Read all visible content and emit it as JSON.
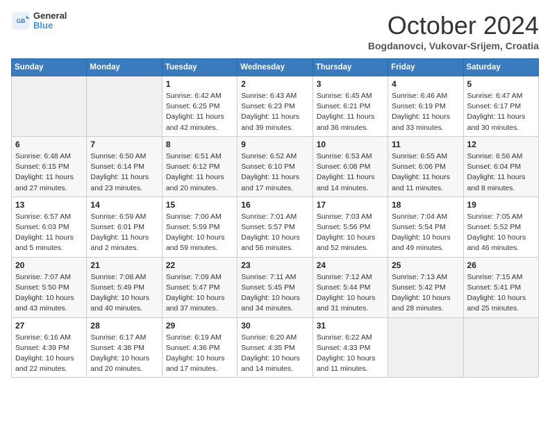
{
  "header": {
    "logo_general": "General",
    "logo_blue": "Blue",
    "title": "October 2024",
    "location": "Bogdanovci, Vukovar-Srijem, Croatia"
  },
  "days_of_week": [
    "Sunday",
    "Monday",
    "Tuesday",
    "Wednesday",
    "Thursday",
    "Friday",
    "Saturday"
  ],
  "weeks": [
    [
      {
        "day": "",
        "sunrise": "",
        "sunset": "",
        "daylight": ""
      },
      {
        "day": "",
        "sunrise": "",
        "sunset": "",
        "daylight": ""
      },
      {
        "day": "1",
        "sunrise": "Sunrise: 6:42 AM",
        "sunset": "Sunset: 6:25 PM",
        "daylight": "Daylight: 11 hours and 42 minutes."
      },
      {
        "day": "2",
        "sunrise": "Sunrise: 6:43 AM",
        "sunset": "Sunset: 6:23 PM",
        "daylight": "Daylight: 11 hours and 39 minutes."
      },
      {
        "day": "3",
        "sunrise": "Sunrise: 6:45 AM",
        "sunset": "Sunset: 6:21 PM",
        "daylight": "Daylight: 11 hours and 36 minutes."
      },
      {
        "day": "4",
        "sunrise": "Sunrise: 6:46 AM",
        "sunset": "Sunset: 6:19 PM",
        "daylight": "Daylight: 11 hours and 33 minutes."
      },
      {
        "day": "5",
        "sunrise": "Sunrise: 6:47 AM",
        "sunset": "Sunset: 6:17 PM",
        "daylight": "Daylight: 11 hours and 30 minutes."
      }
    ],
    [
      {
        "day": "6",
        "sunrise": "Sunrise: 6:48 AM",
        "sunset": "Sunset: 6:15 PM",
        "daylight": "Daylight: 11 hours and 27 minutes."
      },
      {
        "day": "7",
        "sunrise": "Sunrise: 6:50 AM",
        "sunset": "Sunset: 6:14 PM",
        "daylight": "Daylight: 11 hours and 23 minutes."
      },
      {
        "day": "8",
        "sunrise": "Sunrise: 6:51 AM",
        "sunset": "Sunset: 6:12 PM",
        "daylight": "Daylight: 11 hours and 20 minutes."
      },
      {
        "day": "9",
        "sunrise": "Sunrise: 6:52 AM",
        "sunset": "Sunset: 6:10 PM",
        "daylight": "Daylight: 11 hours and 17 minutes."
      },
      {
        "day": "10",
        "sunrise": "Sunrise: 6:53 AM",
        "sunset": "Sunset: 6:08 PM",
        "daylight": "Daylight: 11 hours and 14 minutes."
      },
      {
        "day": "11",
        "sunrise": "Sunrise: 6:55 AM",
        "sunset": "Sunset: 6:06 PM",
        "daylight": "Daylight: 11 hours and 11 minutes."
      },
      {
        "day": "12",
        "sunrise": "Sunrise: 6:56 AM",
        "sunset": "Sunset: 6:04 PM",
        "daylight": "Daylight: 11 hours and 8 minutes."
      }
    ],
    [
      {
        "day": "13",
        "sunrise": "Sunrise: 6:57 AM",
        "sunset": "Sunset: 6:03 PM",
        "daylight": "Daylight: 11 hours and 5 minutes."
      },
      {
        "day": "14",
        "sunrise": "Sunrise: 6:59 AM",
        "sunset": "Sunset: 6:01 PM",
        "daylight": "Daylight: 11 hours and 2 minutes."
      },
      {
        "day": "15",
        "sunrise": "Sunrise: 7:00 AM",
        "sunset": "Sunset: 5:59 PM",
        "daylight": "Daylight: 10 hours and 59 minutes."
      },
      {
        "day": "16",
        "sunrise": "Sunrise: 7:01 AM",
        "sunset": "Sunset: 5:57 PM",
        "daylight": "Daylight: 10 hours and 56 minutes."
      },
      {
        "day": "17",
        "sunrise": "Sunrise: 7:03 AM",
        "sunset": "Sunset: 5:56 PM",
        "daylight": "Daylight: 10 hours and 52 minutes."
      },
      {
        "day": "18",
        "sunrise": "Sunrise: 7:04 AM",
        "sunset": "Sunset: 5:54 PM",
        "daylight": "Daylight: 10 hours and 49 minutes."
      },
      {
        "day": "19",
        "sunrise": "Sunrise: 7:05 AM",
        "sunset": "Sunset: 5:52 PM",
        "daylight": "Daylight: 10 hours and 46 minutes."
      }
    ],
    [
      {
        "day": "20",
        "sunrise": "Sunrise: 7:07 AM",
        "sunset": "Sunset: 5:50 PM",
        "daylight": "Daylight: 10 hours and 43 minutes."
      },
      {
        "day": "21",
        "sunrise": "Sunrise: 7:08 AM",
        "sunset": "Sunset: 5:49 PM",
        "daylight": "Daylight: 10 hours and 40 minutes."
      },
      {
        "day": "22",
        "sunrise": "Sunrise: 7:09 AM",
        "sunset": "Sunset: 5:47 PM",
        "daylight": "Daylight: 10 hours and 37 minutes."
      },
      {
        "day": "23",
        "sunrise": "Sunrise: 7:11 AM",
        "sunset": "Sunset: 5:45 PM",
        "daylight": "Daylight: 10 hours and 34 minutes."
      },
      {
        "day": "24",
        "sunrise": "Sunrise: 7:12 AM",
        "sunset": "Sunset: 5:44 PM",
        "daylight": "Daylight: 10 hours and 31 minutes."
      },
      {
        "day": "25",
        "sunrise": "Sunrise: 7:13 AM",
        "sunset": "Sunset: 5:42 PM",
        "daylight": "Daylight: 10 hours and 28 minutes."
      },
      {
        "day": "26",
        "sunrise": "Sunrise: 7:15 AM",
        "sunset": "Sunset: 5:41 PM",
        "daylight": "Daylight: 10 hours and 25 minutes."
      }
    ],
    [
      {
        "day": "27",
        "sunrise": "Sunrise: 6:16 AM",
        "sunset": "Sunset: 4:39 PM",
        "daylight": "Daylight: 10 hours and 22 minutes."
      },
      {
        "day": "28",
        "sunrise": "Sunrise: 6:17 AM",
        "sunset": "Sunset: 4:38 PM",
        "daylight": "Daylight: 10 hours and 20 minutes."
      },
      {
        "day": "29",
        "sunrise": "Sunrise: 6:19 AM",
        "sunset": "Sunset: 4:36 PM",
        "daylight": "Daylight: 10 hours and 17 minutes."
      },
      {
        "day": "30",
        "sunrise": "Sunrise: 6:20 AM",
        "sunset": "Sunset: 4:35 PM",
        "daylight": "Daylight: 10 hours and 14 minutes."
      },
      {
        "day": "31",
        "sunrise": "Sunrise: 6:22 AM",
        "sunset": "Sunset: 4:33 PM",
        "daylight": "Daylight: 10 hours and 11 minutes."
      },
      {
        "day": "",
        "sunrise": "",
        "sunset": "",
        "daylight": ""
      },
      {
        "day": "",
        "sunrise": "",
        "sunset": "",
        "daylight": ""
      }
    ]
  ]
}
